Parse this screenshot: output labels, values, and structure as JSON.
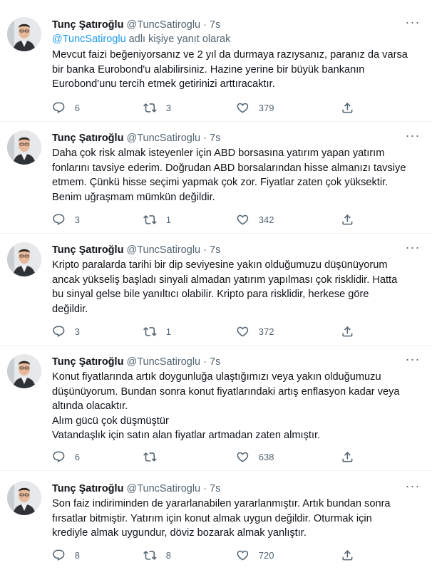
{
  "tweets": [
    {
      "name": "Tunç Şatıroğlu",
      "handle": "@TuncSatiroglu",
      "dot": "·",
      "time": "7s",
      "reply_to_handle": "@TuncSatiroglu",
      "reply_suffix": " adlı kişiye yanıt olarak",
      "text": "Mevcut faizi beğeniyorsanız ve 2 yıl da durmaya razıysanız, paranız da varsa\nbir banka Eurobond'u alabilirsiniz. Hazine yerine bir büyük bankanın\nEurobond'unu tercih etmek getirinizi arttıracaktır.",
      "replies": "6",
      "retweets": "3",
      "likes": "379"
    },
    {
      "name": "Tunç Şatıroğlu",
      "handle": "@TuncSatiroglu",
      "dot": "·",
      "time": "7s",
      "text": "Daha çok risk almak isteyenler için ABD borsasına  yatırım yapan yatırım\nfonlarını tavsiye ederim. Doğrudan ABD borsalarından hisse almanızı tavsiye\netmem. Çünkü hisse seçimi yapmak çok zor. Fiyatlar zaten çok yüksektir.\nBenim uğraşmam mümkün değildir.",
      "replies": "3",
      "retweets": "1",
      "likes": "342"
    },
    {
      "name": "Tunç Şatıroğlu",
      "handle": "@TuncSatiroglu",
      "dot": "·",
      "time": "7s",
      "text": "Kripto paralarda tarihi bir dip seviyesine yakın olduğumuzu düşünüyorum\nancak yükseliş başladı sinyali almadan yatırım yapılması çok risklidir. Hatta\nbu sinyal gelse bile yanıltıcı olabilir. Kripto para risklidir, herkese göre\ndeğildir.",
      "replies": "3",
      "retweets": "1",
      "likes": "372"
    },
    {
      "name": "Tunç Şatıroğlu",
      "handle": "@TuncSatiroglu",
      "dot": "·",
      "time": "7s",
      "text": "Konut fiyatlarında artık doygunluğa ulaştığımızı veya yakın olduğumuzu\ndüşünüyorum. Bundan sonra konut fiyatlarındaki artış enflasyon kadar veya\naltında olacaktır.\nAlım gücü çok düşmüştür\nVatandaşlık için satın alan fiyatlar artmadan zaten almıştır.",
      "replies": "6",
      "retweets": "",
      "likes": "638"
    },
    {
      "name": "Tunç Şatıroğlu",
      "handle": "@TuncSatiroglu",
      "dot": "·",
      "time": "7s",
      "text": "Son faiz indiriminden de yararlanabilen yararlanmıştır. Artık bundan sonra\nfırsatlar bitmiştir. Yatırım için konut almak uygun değildir. Oturmak için\nkrediyle almak uygundur, döviz bozarak almak yanlıştır.",
      "replies": "8",
      "retweets": "8",
      "likes": "720"
    }
  ],
  "icons": {
    "more": "more-horizontal-icon",
    "reply": "reply-bubble-icon",
    "retweet": "retweet-arrows-icon",
    "like": "heart-outline-icon",
    "share": "share-upload-icon"
  },
  "colors": {
    "link": "#1d9bf0",
    "secondary_text": "#536471",
    "separator": "#eff3f4"
  }
}
